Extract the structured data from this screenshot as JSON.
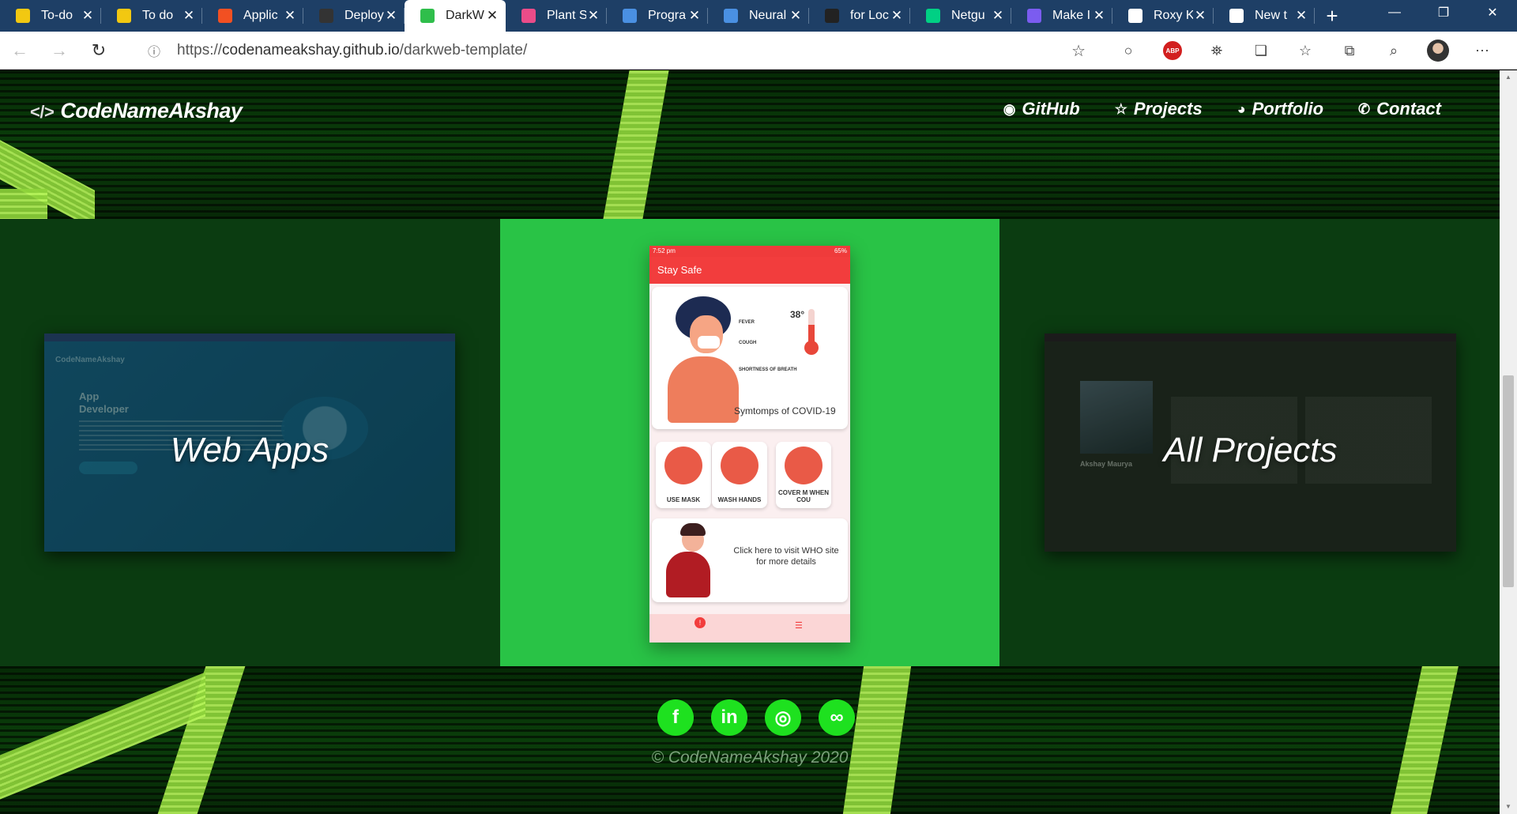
{
  "browser": {
    "tabs": [
      {
        "title": "To-do",
        "icon_color": "#f2c811",
        "active": false
      },
      {
        "title": "To do",
        "icon_color": "#f2c811",
        "active": false
      },
      {
        "title": "Applic",
        "icon_color": "#f25022",
        "active": false
      },
      {
        "title": "Deploy",
        "icon_color": "#333333",
        "active": false
      },
      {
        "title": "DarkW",
        "icon_color": "#2fbe4b",
        "active": true
      },
      {
        "title": "Plant S",
        "icon_color": "#ea4c89",
        "active": false
      },
      {
        "title": "Progra",
        "icon_color": "#4a90e2",
        "active": false
      },
      {
        "title": "Neural",
        "icon_color": "#4a90e2",
        "active": false
      },
      {
        "title": "for Loc",
        "icon_color": "#222222",
        "active": false
      },
      {
        "title": "Netgu",
        "icon_color": "#00d084",
        "active": false
      },
      {
        "title": "Make I",
        "icon_color": "#7b5cf0",
        "active": false
      },
      {
        "title": "Roxy K",
        "icon_color": "#ffffff",
        "active": false
      },
      {
        "title": "New t",
        "icon_color": "#ffffff",
        "active": false
      }
    ],
    "close_glyph": "✕",
    "new_tab_glyph": "+",
    "url_prefix": "https://",
    "url_host": "codenameakshay.github.io",
    "url_path": "/darkweb-template/"
  },
  "site": {
    "logo_mark": "</>",
    "logo_text": "CodeNameAkshay",
    "nav": [
      {
        "icon": "◉",
        "label": "GitHub"
      },
      {
        "icon": "☆",
        "label": "Projects"
      },
      {
        "icon": "◕",
        "label": "Portfolio"
      },
      {
        "icon": "✆",
        "label": "Contact"
      }
    ],
    "panels": {
      "left_title": "Web Apps",
      "right_title": "All Projects"
    },
    "left_shot": {
      "brand": "CodeNameAkshay",
      "heading_1": "App",
      "heading_2": "Developer"
    },
    "right_shot": {
      "name": "Akshay Maurya"
    },
    "phone": {
      "time": "7:52 pm",
      "battery": "65%",
      "app_title": "Stay Safe",
      "temp": "38°",
      "fever": "FEVER",
      "cough": "COUGH",
      "breath": "SHORTNESS OF BREATH",
      "symptoms_caption": "Symtomps of COVID-19",
      "tips": [
        "USE MASK",
        "WASH HANDS",
        "COVER M WHEN COU"
      ],
      "who_text": "Click here to visit WHO site for more details",
      "bottom_alert": "!",
      "bottom_menu": "☰"
    },
    "footer": {
      "socials": [
        {
          "name": "facebook",
          "glyph": "f"
        },
        {
          "name": "linkedin",
          "glyph": "in"
        },
        {
          "name": "instagram",
          "glyph": "◎"
        },
        {
          "name": "link",
          "glyph": "∞"
        }
      ],
      "copyright": "© CodeNameAkshay 2020"
    }
  }
}
